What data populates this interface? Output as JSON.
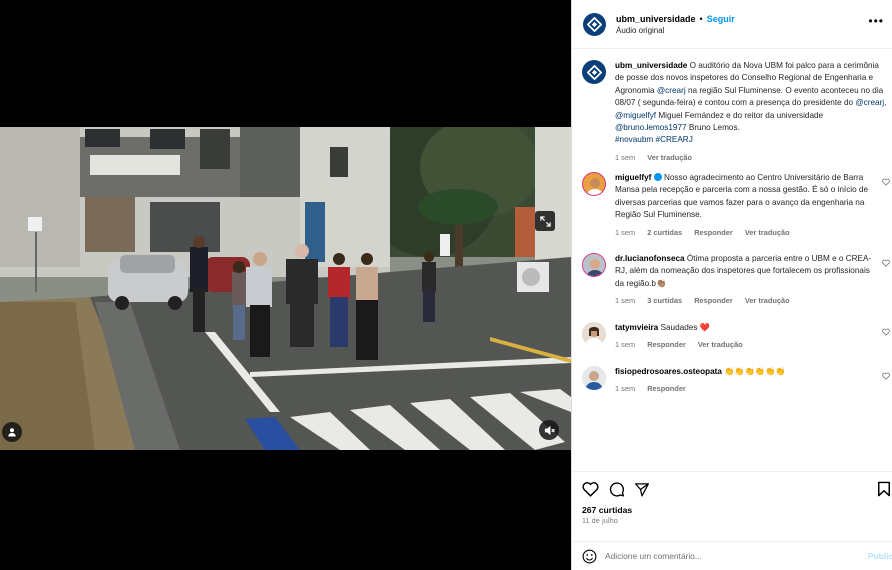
{
  "header": {
    "username": "ubm_universidade",
    "dot": "•",
    "follow_label": "Seguir",
    "audio": "Áudio original"
  },
  "caption": {
    "username": "ubm_universidade",
    "text_1": " O auditório da Nova UBM foi palco para a cerimônia de posse dos novos inspetores do Conselho Regional de Engenharia e Agronomia ",
    "mention_1": "@crearj",
    "text_2": " na região Sul Fluminense. O evento aconteceu no dia 08/07 ( segunda-feira) e contou com a presença do presidente do ",
    "mention_2": "@crearj",
    "text_3": ", ",
    "mention_3": "@miguelfyf",
    "text_4": " Miguel Fernández e do reitor da universidade ",
    "mention_4": "@bruno.lemos1977",
    "text_5": " Bruno Lemos.",
    "hashtags": "#novaubm  #CREARJ",
    "time": "1 sem",
    "translate": "Ver tradução"
  },
  "comments": [
    {
      "username": "miguelfyf",
      "text": "Nosso agradecimento ao Centro Universitário de Barra Mansa pela recepção e parceria com a nossa gestão. É só o início de diversas parcerias que vamos fazer para o avanço da engenharia na Região Sul Fluminense.",
      "time": "1 sem",
      "likes": "2 curtidas",
      "reply": "Responder",
      "translate": "Ver tradução"
    },
    {
      "username": "dr.lucianofonseca",
      "text": "Ótima proposta a parceria entre o UBM e o CREA-RJ, além da nomeação dos inspetores que fortalecem os profissionais da região.b👏🏽",
      "time": "1 sem",
      "likes": "3 curtidas",
      "reply": "Responder",
      "translate": "Ver tradução"
    },
    {
      "username": "tatymvieira",
      "text": "Saudades ❤️",
      "time": "1 sem",
      "reply": "Responder",
      "translate": "Ver tradução"
    },
    {
      "username": "fisiopedrosoares.osteopata",
      "text": "👏👏👏👏👏👏",
      "time": "1 sem",
      "reply": "Responder"
    }
  ],
  "footer": {
    "likes": "267 curtidas",
    "date": "11 de julho",
    "comment_placeholder": "Adicione um comentário...",
    "publish_label": "Publicar"
  },
  "colors": {
    "accent": "#0095f6",
    "brand": "#0a3f7a",
    "link": "#00376b"
  }
}
